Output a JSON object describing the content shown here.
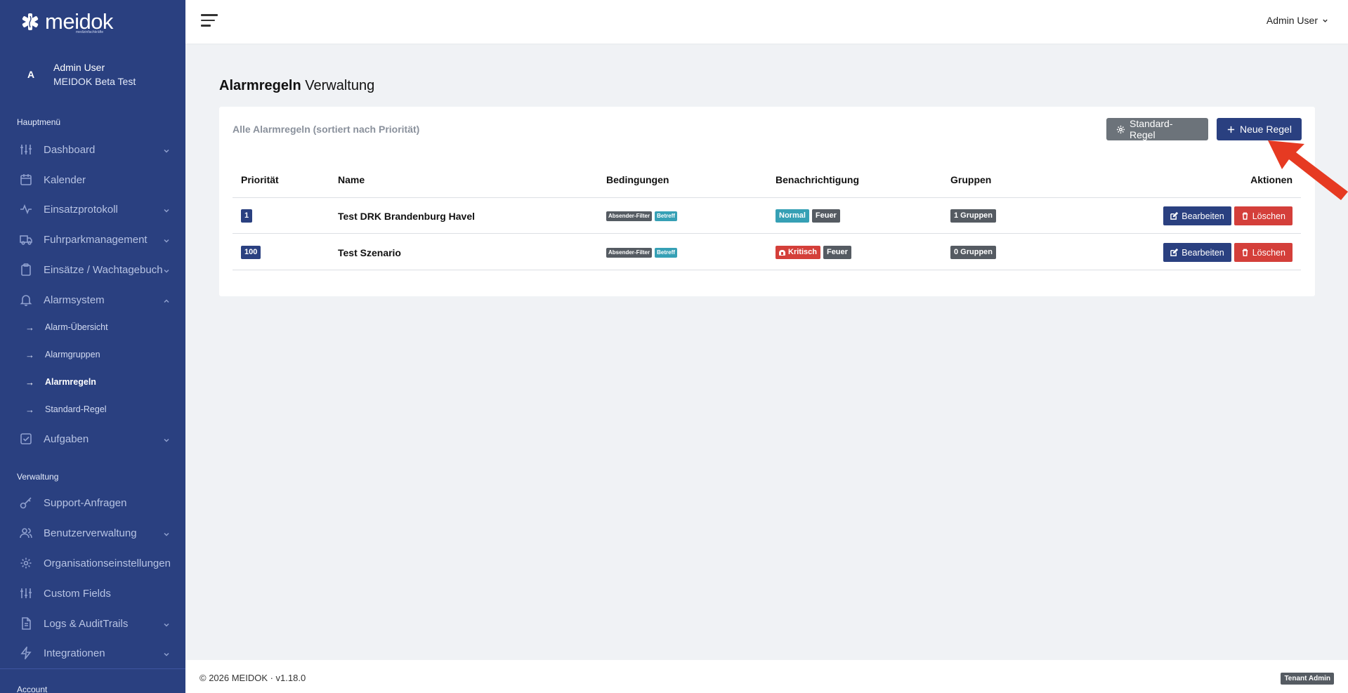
{
  "sidebar": {
    "logo": "meidok",
    "logo_sub": "medizinfachkräfte",
    "user": {
      "avatar_initial": "A",
      "name": "Admin User",
      "tenant": "MEIDOK Beta Test"
    },
    "section_main": "Hauptmenü",
    "main_items": [
      {
        "label": "Dashboard",
        "icon": "sliders-icon"
      },
      {
        "label": "Kalender",
        "icon": "calendar-icon"
      },
      {
        "label": "Einsatzprotokoll",
        "icon": "activity-icon"
      },
      {
        "label": "Fuhrparkmanagement",
        "icon": "truck-icon"
      },
      {
        "label": "Einsätze / Wachtagebuch",
        "icon": "clipboard-icon"
      },
      {
        "label": "Alarmsystem",
        "icon": "bell-icon"
      }
    ],
    "alarm_sub_items": [
      {
        "label": "Alarm-Übersicht"
      },
      {
        "label": "Alarmgruppen"
      },
      {
        "label": "Alarmregeln"
      },
      {
        "label": "Standard-Regel"
      }
    ],
    "aufgaben": {
      "label": "Aufgaben",
      "icon": "check-square-icon"
    },
    "section_admin": "Verwaltung",
    "admin_items": [
      {
        "label": "Support-Anfragen",
        "icon": "key-icon"
      },
      {
        "label": "Benutzerverwaltung",
        "icon": "users-icon"
      },
      {
        "label": "Organisationseinstellungen",
        "icon": "gear-icon"
      },
      {
        "label": "Custom Fields",
        "icon": "sliders-icon"
      },
      {
        "label": "Logs & AuditTrails",
        "icon": "file-text-icon"
      },
      {
        "label": "Integrationen",
        "icon": "zap-icon"
      }
    ],
    "section_account": "Account",
    "colors": {
      "background": "#2a4080"
    }
  },
  "topbar": {
    "user_menu": "Admin User"
  },
  "page": {
    "title_bold": "Alarmregeln",
    "title_rest": " Verwaltung"
  },
  "card": {
    "header": "Alle Alarmregeln (sortiert nach Priorität)",
    "btn_default_rule": "Standard-Regel",
    "btn_new_rule": "Neue Regel",
    "columns": [
      "Priorität",
      "Name",
      "Bedingungen",
      "Benachrichtigung",
      "Gruppen",
      "Aktionen"
    ],
    "rows": [
      {
        "priority": "1",
        "name": "Test DRK Brandenburg Havel",
        "conditions": [
          "Absender-Filter",
          "Betreff"
        ],
        "notification": {
          "level": "Normal",
          "level_color": "#36a0b5",
          "type": "Feuer"
        },
        "groups": "1 Gruppen",
        "edit": "Bearbeiten",
        "delete": "Löschen"
      },
      {
        "priority": "100",
        "name": "Test Szenario",
        "conditions": [
          "Absender-Filter",
          "Betreff"
        ],
        "notification": {
          "level": "Kritisch",
          "level_color": "#d43f3a",
          "type": "Feuer"
        },
        "groups": "0 Gruppen",
        "edit": "Bearbeiten",
        "delete": "Löschen"
      }
    ]
  },
  "footer": {
    "copyright": "© 2026 MEIDOK · v1.18.0",
    "role_badge": "Tenant Admin"
  }
}
